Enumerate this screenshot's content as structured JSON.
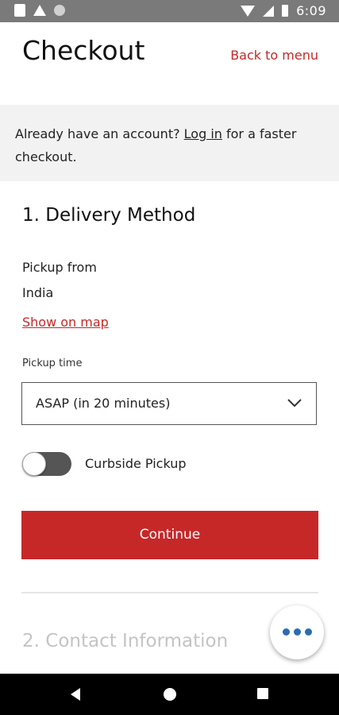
{
  "status_bar": {
    "time": "6:09"
  },
  "header": {
    "title": "Checkout",
    "back_label": "Back to menu"
  },
  "login_banner": {
    "prefix": "Already have an account? ",
    "link_label": "Log in",
    "suffix": " for a faster checkout."
  },
  "delivery": {
    "section_title": "1. Delivery Method",
    "pickup_label": "Pickup from",
    "pickup_location": "India",
    "map_link": "Show on map",
    "time_label": "Pickup time",
    "time_value": "ASAP (in 20 minutes)",
    "curbside_label": "Curbside Pickup",
    "curbside_enabled": false,
    "continue_label": "Continue"
  },
  "contact": {
    "section_title": "2. Contact Information"
  },
  "colors": {
    "accent": "#c62828",
    "fab_dots": "#2b6cb0",
    "banner_bg": "#f2f2f2"
  },
  "icons": {
    "status": [
      "notification-square-icon",
      "warning-icon",
      "sync-icon",
      "wifi-icon",
      "cell-signal-icon",
      "battery-icon"
    ],
    "select_chevron": "chevron-down-icon",
    "fab": "more-dots-icon",
    "nav": [
      "nav-back-icon",
      "nav-home-icon",
      "nav-recents-icon"
    ]
  }
}
